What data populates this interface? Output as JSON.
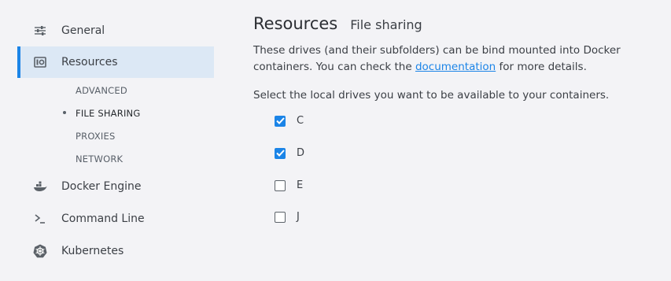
{
  "sidebar": {
    "items": [
      {
        "label": "General",
        "icon": "sliders-icon"
      },
      {
        "label": "Resources",
        "icon": "resources-icon",
        "active": true
      },
      {
        "label": "Docker Engine",
        "icon": "whale-icon"
      },
      {
        "label": "Command Line",
        "icon": "terminal-icon"
      },
      {
        "label": "Kubernetes",
        "icon": "kubernetes-icon"
      }
    ],
    "subitems": [
      "ADVANCED",
      "FILE SHARING",
      "PROXIES",
      "NETWORK"
    ],
    "current_subitem": "FILE SHARING"
  },
  "main": {
    "title": "Resources",
    "subtitle": "File sharing",
    "desc_part1": "These drives (and their subfolders) can be bind mounted into Docker containers. You can check the ",
    "desc_link": "documentation",
    "desc_part2": " for more details.",
    "instruction": "Select the local drives you want to be available to your containers.",
    "drives": [
      {
        "label": "C",
        "checked": true
      },
      {
        "label": "D",
        "checked": true
      },
      {
        "label": "E",
        "checked": false
      },
      {
        "label": "J",
        "checked": false
      }
    ]
  },
  "colors": {
    "accent": "#1b84e7",
    "active_bg": "#dce8f5",
    "background": "#f3f3f6"
  }
}
